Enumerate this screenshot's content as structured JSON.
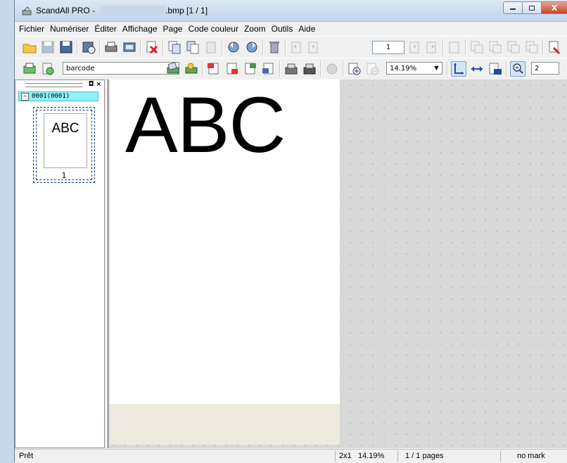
{
  "window": {
    "app_name": "ScandAll PRO -",
    "file_suffix": ".bmp  [1 / 1]",
    "close_label": "X"
  },
  "menu": [
    "Fichier",
    "Numériser",
    "Éditer",
    "Affichage",
    "Page",
    "Code couleur",
    "Zoom",
    "Outils",
    "Aide"
  ],
  "toolbar": {
    "page_number": "1",
    "profile_select": "barcode",
    "zoom_select": "14.19%",
    "zoom_partial": "2"
  },
  "panel": {
    "tree_node_label": "0001(0001)",
    "thumbnail_text": "ABC",
    "thumbnail_page_number": "1"
  },
  "document": {
    "text": "ABC"
  },
  "status": {
    "state": "Prêt",
    "layout": "2x1",
    "zoom": "14.19%",
    "pages": "1 / 1 pages",
    "mark": "no mark"
  }
}
